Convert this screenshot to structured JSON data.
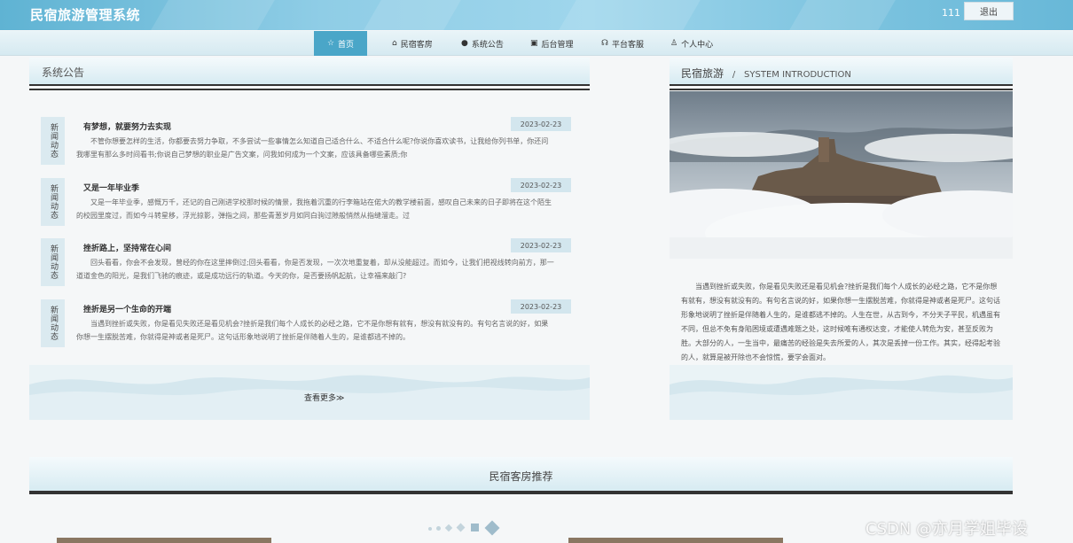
{
  "header": {
    "app_title": "民宿旅游管理系统",
    "user_name": "111",
    "logout_label": "退出"
  },
  "nav": {
    "items": [
      {
        "label": "首页",
        "icon": "star-icon",
        "glyph": "☆"
      },
      {
        "label": "民宿客房",
        "icon": "bed-icon",
        "glyph": "⌂"
      },
      {
        "label": "系统公告",
        "icon": "info-icon",
        "glyph": "●"
      },
      {
        "label": "后台管理",
        "icon": "briefcase-icon",
        "glyph": "▣"
      },
      {
        "label": "平台客服",
        "icon": "headset-icon",
        "glyph": "☊"
      },
      {
        "label": "个人中心",
        "icon": "user-icon",
        "glyph": "♙"
      }
    ]
  },
  "notice": {
    "title": "系统公告",
    "tag_label": "新闻动态",
    "items": [
      {
        "title": "有梦想，就要努力去实现",
        "date": "2023-02-23",
        "summary": "不管你想要怎样的生活，你都要去努力争取，不多尝试一些事情怎么知道自己适合什么、不适合什么呢?你说你喜欢读书，让我给你列书单，你还问我哪里有那么多时间看书;你说自己梦想的职业是广告文案，问我如何成为一个文案，应该具备哪些素质;你"
      },
      {
        "title": "又是一年毕业季",
        "date": "2023-02-23",
        "summary": "又是一年毕业季，感慨万千，还记的自己刚进学校那时候的情景，我拖着沉重的行李箱站在偌大的教学楼前面，感叹自己未来的日子即将在这个陌生的校园里度过，而如今斗转星移，浮光掠影，弹指之间，那些青葱岁月如同白驹过隙般悄然从指缝溜走。过"
      },
      {
        "title": "挫折路上，坚持常在心间",
        "date": "2023-02-23",
        "summary": "回头看看，你会不会发现，曾经的你在这里摔倒过;回头看看，你是否发现，一次次地重复着，却从没能超过。而如今，让我们把视线转向前方，那一道道金色的阳光，是我们飞驰的痕迹，或是成功远行的轨道。今天的你，是否要扬帆起航，让幸福来敲门?"
      },
      {
        "title": "挫折是另一个生命的开端",
        "date": "2023-02-23",
        "summary": "当遇到挫折或失败，你是看见失败还是看见机会?挫折是我们每个人成长的必经之路，它不是你想有就有，想没有就没有的。有句名言说的好，如果你想一生摆脱苦难，你就得是神或者是死尸。这句话形象地说明了挫折是伴随着人生的，是谁都逃不掉的。"
      }
    ],
    "more_label": "查看更多≫"
  },
  "intro": {
    "title": "民宿旅游",
    "separator": "/",
    "subtitle": "SYSTEM INTRODUCTION",
    "text": "当遇到挫折或失败，你是看见失败还是看见机会?挫折是我们每个人成长的必经之路，它不是你想有就有，想没有就没有的。有句名言说的好，如果你想一生摆脱苦难，你就得是神或者是死尸。这句话形象地说明了挫折是伴随着人生的，是谁都逃不掉的。人生在世，从古到今，不分天子平民，机遇虽有不同，但总不免有身陷困境或遭遇难题之处，这时候唯有通权达变，才能使人转危为安，甚至反败为胜。大部分的人，一生当中，最痛苦的经验是失去所爱的人，其次是丢掉一份工作。其实，经得起考验的人，就算是被开除也不会惊慌，要学会面对。"
  },
  "recommend": {
    "title": "民宿客房推荐"
  },
  "watermark": "CSDN @亦月学姐毕设",
  "colors": {
    "accent": "#4aa6c8",
    "header_bg": "#7cc3df",
    "date_bg": "#d3e6ee"
  }
}
